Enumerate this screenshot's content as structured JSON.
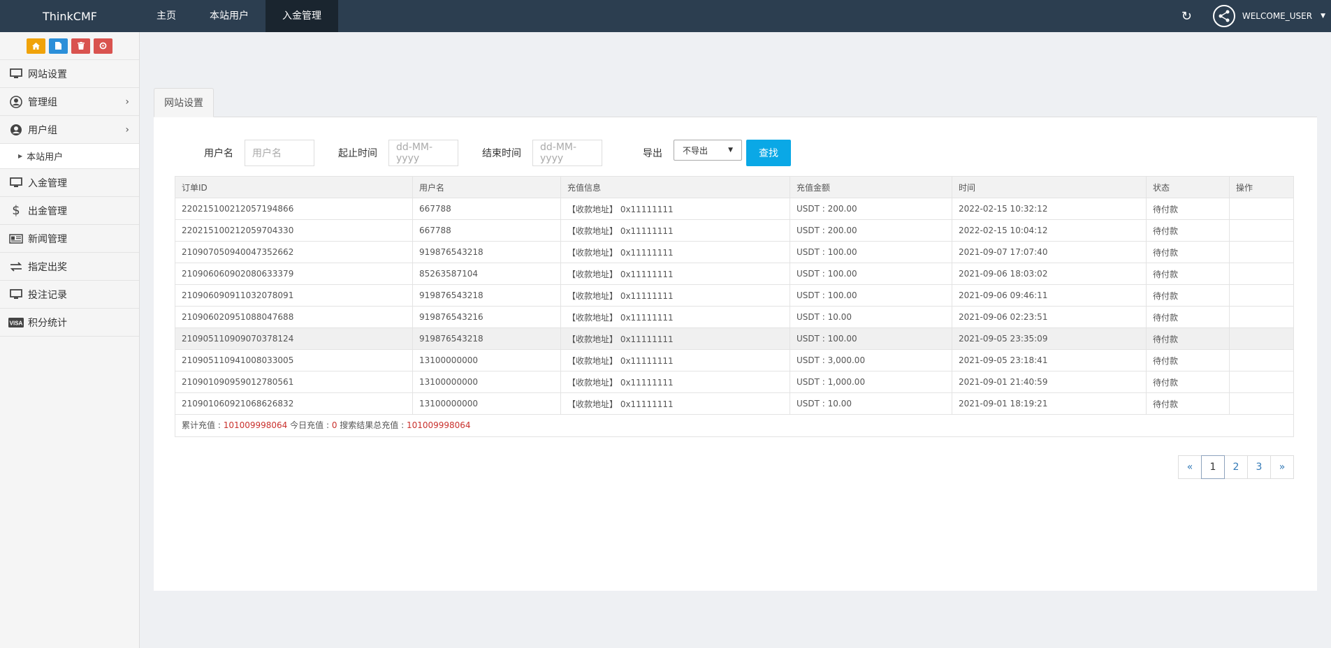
{
  "brand": "ThinkCMF",
  "topnav": [
    {
      "label": "主页"
    },
    {
      "label": "本站用户"
    },
    {
      "label": "入金管理"
    }
  ],
  "user": {
    "welcome": "WELCOME_USER"
  },
  "colors": {
    "topbar": "#2c3e50",
    "active_nav": "#1a252f",
    "search_button": "#0aa8e6",
    "shortcut_home": "#f0a30a",
    "shortcut_doc": "#2b8fd9",
    "shortcut_delete": "#d9534f",
    "shortcut_recycle": "#d9534f"
  },
  "shortcut_icons": [
    "home-icon",
    "file-icon",
    "trash-icon",
    "recycle-icon"
  ],
  "sidebar": {
    "items": [
      {
        "label": "网站设置",
        "icon": "monitor-icon"
      },
      {
        "label": "管理组",
        "icon": "user-circle-icon"
      },
      {
        "label": "用户组",
        "icon": "user-circle-icon"
      },
      {
        "label": "本站用户",
        "icon": "caret-right-icon"
      },
      {
        "label": "入金管理",
        "icon": "monitor-icon"
      },
      {
        "label": "出金管理",
        "icon": "dollar-icon"
      },
      {
        "label": "新闻管理",
        "icon": "newspaper-icon"
      },
      {
        "label": "指定出奖",
        "icon": "exchange-icon"
      },
      {
        "label": "投注记录",
        "icon": "monitor-icon"
      },
      {
        "label": "积分统计",
        "icon": "visa-icon"
      }
    ]
  },
  "tab": {
    "label": "网站设置"
  },
  "filters": {
    "username_label": "用户名",
    "username_placeholder": "用户名",
    "start_label": "起止时间",
    "start_placeholder": "dd-MM-yyyy",
    "end_label": "结束时间",
    "end_placeholder": "dd-MM-yyyy",
    "export_label": "导出",
    "export_value": "不导出",
    "search_label": "查找"
  },
  "table": {
    "headers": [
      "订单ID",
      "用户名",
      "充值信息",
      "充值金额",
      "时间",
      "状态",
      "操作"
    ],
    "rows": [
      [
        "220215100212057194866",
        "667788",
        "【收款地址】 0x11111111",
        "USDT : 200.00",
        "2022-02-15 10:32:12",
        "待付款",
        ""
      ],
      [
        "220215100212059704330",
        "667788",
        "【收款地址】 0x11111111",
        "USDT : 200.00",
        "2022-02-15 10:04:12",
        "待付款",
        ""
      ],
      [
        "210907050940047352662",
        "919876543218",
        "【收款地址】 0x11111111",
        "USDT : 100.00",
        "2021-09-07 17:07:40",
        "待付款",
        ""
      ],
      [
        "210906060902080633379",
        "85263587104",
        "【收款地址】 0x11111111",
        "USDT : 100.00",
        "2021-09-06 18:03:02",
        "待付款",
        ""
      ],
      [
        "210906090911032078091",
        "919876543218",
        "【收款地址】 0x11111111",
        "USDT : 100.00",
        "2021-09-06 09:46:11",
        "待付款",
        ""
      ],
      [
        "210906020951088047688",
        "919876543216",
        "【收款地址】 0x11111111",
        "USDT : 10.00",
        "2021-09-06 02:23:51",
        "待付款",
        ""
      ],
      [
        "210905110909070378124",
        "919876543218",
        "【收款地址】 0x11111111",
        "USDT : 100.00",
        "2021-09-05 23:35:09",
        "待付款",
        ""
      ],
      [
        "210905110941008033005",
        "13100000000",
        "【收款地址】 0x11111111",
        "USDT : 3,000.00",
        "2021-09-05 23:18:41",
        "待付款",
        ""
      ],
      [
        "210901090959012780561",
        "13100000000",
        "【收款地址】 0x11111111",
        "USDT : 1,000.00",
        "2021-09-01 21:40:59",
        "待付款",
        ""
      ],
      [
        "210901060921068626832",
        "13100000000",
        "【收款地址】 0x11111111",
        "USDT : 10.00",
        "2021-09-01 18:19:21",
        "待付款",
        ""
      ]
    ],
    "highlighted_row": 6
  },
  "summary": {
    "total_label": "累计充值 : ",
    "total_value": "101009998064",
    "today_label": " 今日充值 : ",
    "today_value": "0",
    "search_total_label": " 搜索结果总充值 : ",
    "search_total_value": "101009998064"
  },
  "pagination": {
    "prev": "«",
    "pages": [
      "1",
      "2",
      "3"
    ],
    "current": "1",
    "next": "»"
  }
}
